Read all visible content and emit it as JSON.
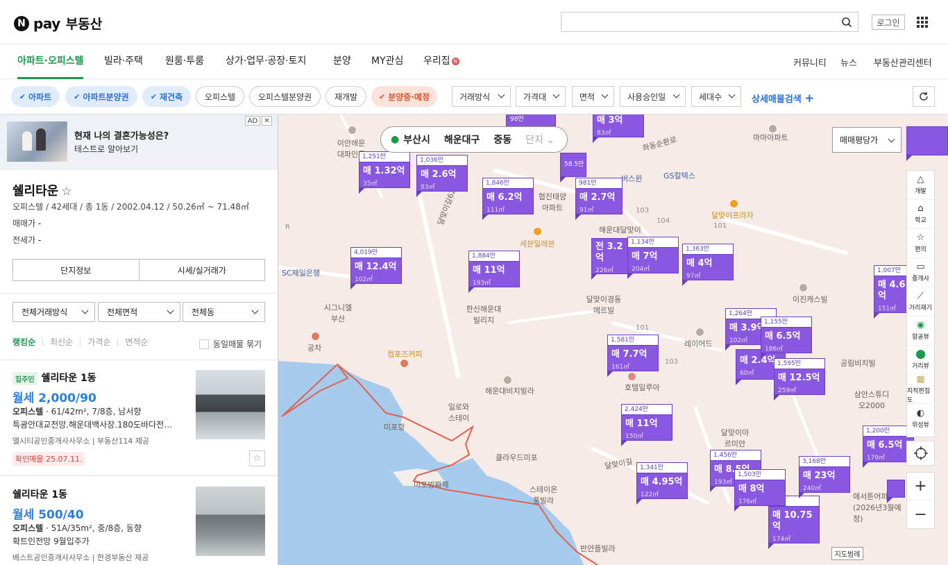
{
  "header": {
    "logo_badge": "N",
    "logo_pay": "pay",
    "logo_name": "부동산",
    "login": "로그인",
    "search_placeholder": ""
  },
  "nav": {
    "items": [
      "아파트·오피스텔",
      "빌라·주택",
      "원룸·투룸",
      "상가·업무·공장·토지",
      "분양",
      "MY관심",
      "우리집"
    ],
    "right": [
      "커뮤니티",
      "뉴스",
      "부동산관리센터"
    ],
    "badge": "N"
  },
  "filters": {
    "chips": [
      "아파트",
      "아파트분양권",
      "재건축",
      "오피스텔",
      "오피스텔분양권",
      "재개발",
      "분양중·예정"
    ],
    "dropdowns": [
      "거래방식",
      "가격대",
      "면적",
      "사용승인일",
      "세대수"
    ],
    "detail": "상세매물검색",
    "detail_plus": "+"
  },
  "ad": {
    "title": "현재 나의 결혼가능성은?",
    "subtitle": "테스트로 알아보기",
    "badge": "AD",
    "close": "✕"
  },
  "building": {
    "name": "쉘리타운",
    "star": "☆",
    "info": "오피스텔 / 42세대 / 총 1동 / 2002.04.12 / 50.26㎡ ~ 71.48㎡",
    "sale_label": "매매가",
    "sale_value": "-",
    "jeonse_label": "전세가",
    "jeonse_value": "-",
    "tab_info": "단지정보",
    "tab_price": "시세/실거래가"
  },
  "list_filters": {
    "selects": [
      "전체거래방식",
      "전체면적",
      "전체동"
    ],
    "sorts": [
      "랭킹순",
      "최신순",
      "가격순",
      "면적순"
    ],
    "group": "동일매물 묶기"
  },
  "listings": [
    {
      "badge": "집주인",
      "title": "쉘리타운 1동",
      "price": "월세 2,000/90",
      "type": "오피스텔",
      "spec": " · 61/42m², 7/8층, 남서향",
      "desc": "특광안대교전망.해운대백사장.180도바다전…",
      "agent": "엘시티공인중개사사무소 | 부동산114 제공",
      "confirm": "확인매물 25.07.11."
    },
    {
      "badge": "",
      "title": "쉘리타운 1동",
      "price": "월세 500/40",
      "type": "오피스텔",
      "spec": " · 51A/35m², 중/8층, 동향",
      "desc": "확트인전망 9월입주가",
      "agent": "베스트공인중개사사무소 | 한경부동산 제공",
      "confirm": ""
    }
  ],
  "map": {
    "location": [
      "부산시",
      "해운대구",
      "중동",
      "단지"
    ],
    "type_select": "매매평당가",
    "scale": "지도범례",
    "tools": [
      "개발",
      "학교",
      "편의",
      "중개사",
      "거리재기",
      "항공뷰",
      "거리뷰",
      "지적편집도",
      "위성뷰"
    ],
    "zoom_in": "+",
    "zoom_out": "−",
    "markers": [
      {
        "unit": "1,251만",
        "price": "매 1.32억",
        "area": "35㎡"
      },
      {
        "unit": "1,036만",
        "price": "매 2.6억",
        "area": "83㎡"
      },
      {
        "unit": "1,846만",
        "price": "매 6.2억",
        "area": "111㎡"
      },
      {
        "unit": "981만",
        "price": "매 2.7억",
        "area": "91㎡"
      },
      {
        "unit": "4,019만",
        "price": "매 12.4억",
        "area": "102㎡"
      },
      {
        "unit": "1,884만",
        "price": "매 11억",
        "area": "193㎡"
      },
      {
        "unit": "1,134만",
        "price": "매 7억",
        "area": "204㎡"
      },
      {
        "unit": "1,363만",
        "price": "매 4억",
        "area": "97㎡"
      },
      {
        "unit": "1,264만",
        "price": "매 3.9억",
        "area": "102㎡"
      },
      {
        "unit": "1,155만",
        "price": "매 6.5억",
        "area": "186㎡"
      },
      {
        "unit": "1,581만",
        "price": "매 7.7억",
        "area": "161㎡"
      },
      {
        "unit": "1,595만",
        "price": "매 12.5억",
        "area": "259㎡"
      },
      {
        "unit": "2,424만",
        "price": "매 11억",
        "area": "150㎡"
      },
      {
        "unit": "1,341만",
        "price": "매 4.95억",
        "area": "122㎡"
      },
      {
        "unit": "1,456만",
        "price": "매 8.5억",
        "area": "193㎡"
      },
      {
        "unit": "1,503만",
        "price": "매 8억",
        "area": "176㎡"
      },
      {
        "unit": "3,168만",
        "price": "매 23억",
        "area": "240㎡"
      },
      {
        "unit": "1,200만",
        "price": "매 6.5억",
        "area": "179㎡"
      },
      {
        "unit": "1,007만",
        "price": "매 4.6억",
        "area": "151㎡"
      },
      {
        "unit": "",
        "price": "매 3억",
        "area": "83㎡"
      },
      {
        "unit": "",
        "price": "전 3.2억",
        "area": "226㎡"
      },
      {
        "unit": "",
        "price": "매 2.4억",
        "area": "60㎡"
      },
      {
        "unit": "",
        "price": "매 10.75억",
        "area": "174㎡"
      }
    ],
    "labels": [
      "이안해운대파인몰",
      "마마아파트",
      "좌동순환로",
      "버스윈",
      "GS칼텍스",
      "협진태양아파트",
      "세븐일레븐",
      "달맞이프라자",
      "해운대달맞이",
      "SC제일은행",
      "시그니엘부산",
      "한신해운대빌리지",
      "달맞이경동메르빌",
      "이진캐스빌",
      "레이어드",
      "공차",
      "컴포즈커피",
      "해운대비치빌라",
      "일로와스테이",
      "호텔일루아",
      "삼안스튜디오2000",
      "미포항",
      "미포방파제",
      "클라우드미포",
      "달맞이아르미안",
      "스테이온풀빌라",
      "공림비치빌",
      "애서튼어퍼 (2026년3월예정)",
      "반얀플빌라",
      "달맞이길62",
      "달맞이길",
      "98만",
      "58.5만"
    ]
  }
}
